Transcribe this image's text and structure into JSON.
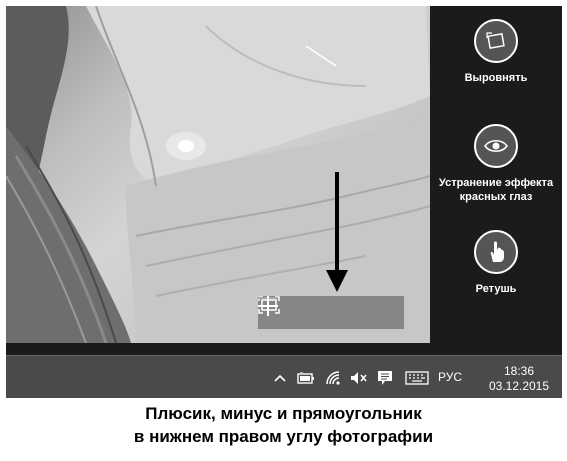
{
  "edit_panel": {
    "tools": [
      {
        "label": "Выровнять",
        "icon": "straighten-icon"
      },
      {
        "label": "Устранение эффекта красных глаз",
        "icon": "eye-icon"
      },
      {
        "label": "Ретушь",
        "icon": "touch-hand-icon"
      }
    ]
  },
  "zoom_controls": {
    "fit": "fit-to-window-icon",
    "minus": "zoom-out-icon",
    "plus": "zoom-in-icon"
  },
  "taskbar": {
    "language": "РУС",
    "time": "18:36",
    "date": "03.12.2015"
  },
  "caption": {
    "line1": "Плюсик, минус и прямоугольник",
    "line2": "в нижнем правом углу фотографии"
  }
}
